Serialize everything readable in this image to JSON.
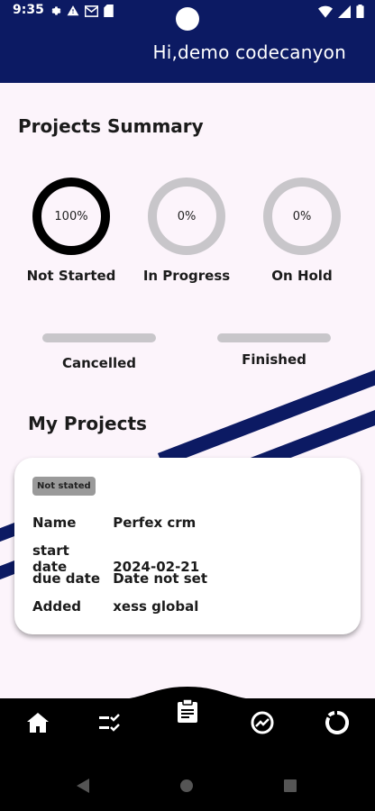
{
  "status_bar": {
    "time": "9:35"
  },
  "header": {
    "greeting": "Hi,demo codecanyon"
  },
  "summary": {
    "title": "Projects Summary",
    "rings": [
      {
        "label": "Not Started",
        "percent_text": "100%",
        "value": 1.0
      },
      {
        "label": "In Progress",
        "percent_text": "0%",
        "value": 0.0
      },
      {
        "label": "On Hold",
        "percent_text": "0%",
        "value": 0.0
      }
    ],
    "bars": [
      {
        "label": "Cancelled",
        "value": 0.0
      },
      {
        "label": "Finished",
        "value": 0.0
      }
    ]
  },
  "projects": {
    "title": "My Projects",
    "items": [
      {
        "badge": "Not stated",
        "fields": [
          {
            "key": "Name",
            "value": "Perfex crm"
          },
          {
            "key": "start date",
            "value": "2024-02-21"
          },
          {
            "key": "due date",
            "value": "Date not set"
          },
          {
            "key": "Added",
            "value": "xess global"
          }
        ]
      }
    ]
  },
  "bottom_nav": {
    "items": [
      "home-icon",
      "task-list-icon",
      "clipboard-icon",
      "analytics-icon",
      "progress-ring-icon"
    ]
  },
  "colors": {
    "brand": "#0c1a63",
    "background": "#fcf4fb",
    "ring_active": "#000000",
    "ring_inactive": "#c8c6ca"
  }
}
